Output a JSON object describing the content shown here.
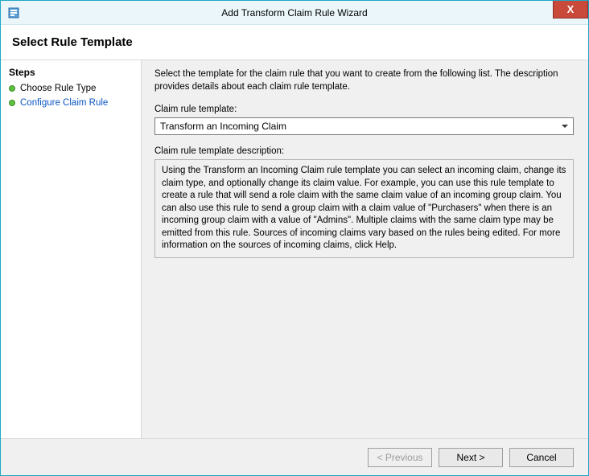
{
  "window": {
    "title": "Add Transform Claim Rule Wizard",
    "close_label": "X"
  },
  "header": {
    "title": "Select Rule Template"
  },
  "sidebar": {
    "heading": "Steps",
    "items": [
      {
        "label": "Choose Rule Type",
        "state": "done"
      },
      {
        "label": "Configure Claim Rule",
        "state": "active"
      }
    ]
  },
  "content": {
    "intro": "Select the template for the claim rule that you want to create from the following list. The description provides details about each claim rule template.",
    "template_label": "Claim rule template:",
    "template_value": "Transform an Incoming Claim",
    "description_label": "Claim rule template description:",
    "description_text": "Using the Transform an Incoming Claim rule template you can select an incoming claim, change its claim type, and optionally change its claim value.  For example, you can use this rule template to create a rule that will send a role claim with the same claim value of an incoming group claim.  You can also use this rule to send a group claim with a claim value of \"Purchasers\" when there is an incoming group claim with a value of \"Admins\".  Multiple claims with the same claim type may be emitted from this rule.  Sources of incoming claims vary based on the rules being edited.  For more information on the sources of incoming claims, click Help."
  },
  "buttons": {
    "previous": "< Previous",
    "next": "Next >",
    "cancel": "Cancel"
  }
}
